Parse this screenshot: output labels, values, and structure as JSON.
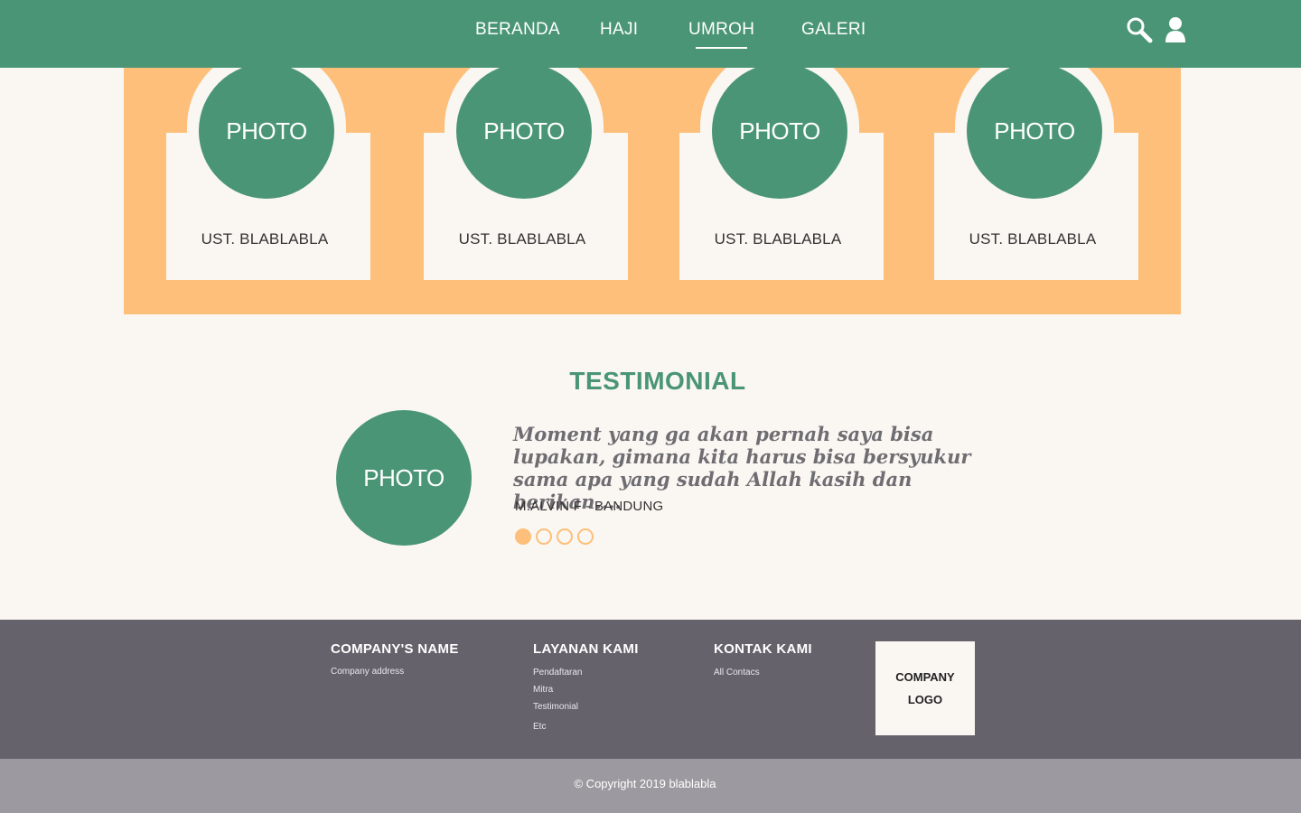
{
  "nav": {
    "items": [
      {
        "label": "BERANDA"
      },
      {
        "label": "HAJI"
      },
      {
        "label": "UMROH"
      },
      {
        "label": "GALERI"
      }
    ],
    "active": "UMROH",
    "icons": [
      "search-icon",
      "user-icon"
    ]
  },
  "ustadz": {
    "cards": [
      {
        "photo": "PHOTO",
        "name": "UST. BLABLABLA"
      },
      {
        "photo": "PHOTO",
        "name": "UST. BLABLABLA"
      },
      {
        "photo": "PHOTO",
        "name": "UST. BLABLABLA"
      },
      {
        "photo": "PHOTO",
        "name": "UST. BLABLABLA"
      }
    ]
  },
  "testimonial": {
    "title": "TESTIMONIAL",
    "photo": "PHOTO",
    "quote": "Moment yang ga akan pernah saya bisa lupakan, gimana kita harus bisa bersyukur sama apa yang sudah Allah kasih dan berikan....",
    "author": "M.ALVIN F - BANDUNG",
    "dots": 4,
    "active_dot": 1
  },
  "footer": {
    "company": {
      "heading": "COMPANY'S NAME",
      "address": "Company address"
    },
    "layanan": {
      "heading": "LAYANAN KAMI",
      "items": [
        "Pendaftaran",
        "Mitra",
        "Testimonial",
        "Etc"
      ]
    },
    "kontak": {
      "heading": "KONTAK KAMI",
      "items": [
        "All Contacs"
      ]
    },
    "logo": {
      "line1": "COMPANY",
      "line2": "LOGO"
    },
    "copyright": "© Copyright 2019 blablabla"
  },
  "colors": {
    "green": "#4a9576",
    "orange": "#fdbf79",
    "cream": "#faf6f2",
    "footer_dark": "#65626b",
    "footer_light": "#9c9aa0"
  }
}
